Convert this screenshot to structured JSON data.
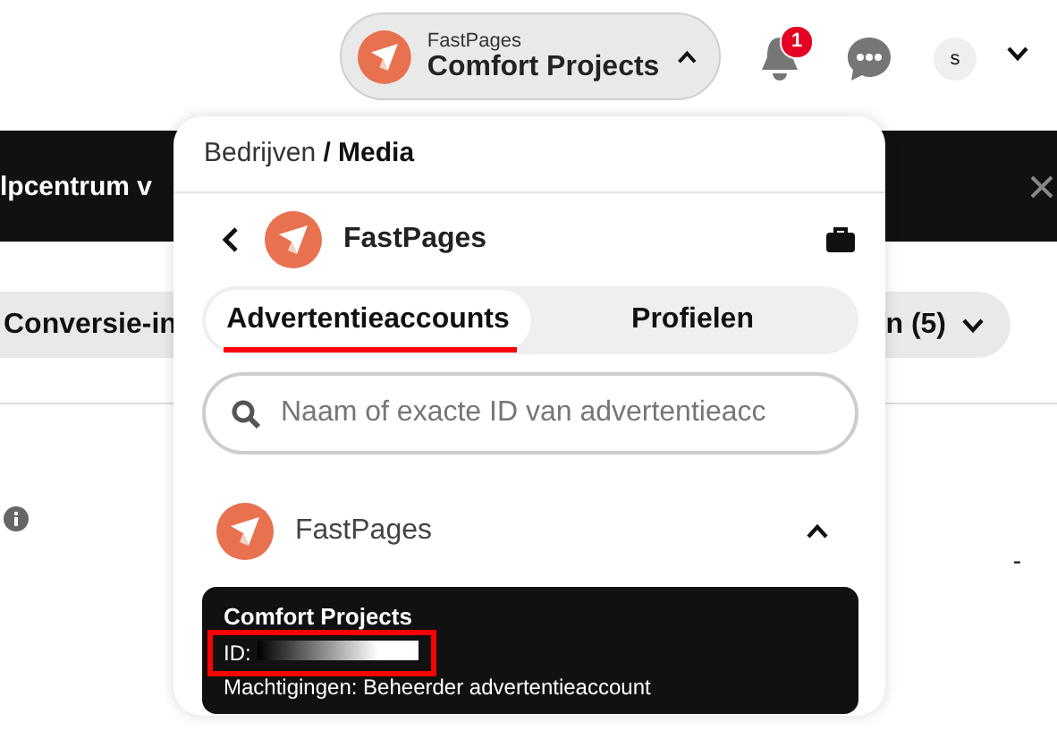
{
  "top_bar": {
    "account_switcher": {
      "business": "FastPages",
      "account": "Comfort Projects",
      "expanded": true
    },
    "notifications": {
      "badge": "1"
    },
    "avatar": "s"
  },
  "background": {
    "banner": {
      "text": "lpcentrum v"
    },
    "chips": [
      {
        "label": "Conversie-in"
      },
      {
        "label": "n (5)"
      }
    ],
    "value": "-"
  },
  "dropdown": {
    "breadcrumb": "Bedrijven **/ Media**",
    "business": "FastPages",
    "tabs": [
      {
        "label": "Advertentieaccounts",
        "selected": true,
        "red_underline": true
      },
      {
        "label": "Profielen",
        "selected": false,
        "red_underline": false
      }
    ],
    "search": {
      "placeholder": "Naam of exacte ID van advertentieacc"
    },
    "groups": [
      {
        "name": "FastPages",
        "expanded": true,
        "accounts": [
          {
            "name": "Comfort Projects",
            "id_label": "ID:",
            "id_marked": true,
            "permissions": "Machtigingen: Beheerder advertentieaccount"
          }
        ]
      }
    ]
  }
}
